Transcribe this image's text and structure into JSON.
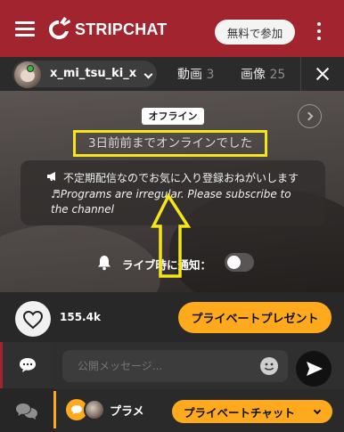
{
  "header": {
    "brand": "STRIPCHAT",
    "join_label": "無料で参加",
    "colors": {
      "brand_red": "#a2242f",
      "accent_orange": "#ffaa1c"
    }
  },
  "model_bar": {
    "model_name": "x_mi_tsu_ki_x",
    "tabs": [
      {
        "label": "動画",
        "count": "3"
      },
      {
        "label": "画像",
        "count": "25"
      }
    ]
  },
  "video": {
    "status_badge": "オフライン",
    "last_online": "3日前前までオンラインでした",
    "notice_ja": "不定期配信なのでお気に入り登録おねがいします",
    "notice_en": "♬Programs are irregular. Please subscribe to the channel",
    "notify_label": "ライブ時に通知："
  },
  "actions": {
    "like_count": "155.4k",
    "private_present_label": "プライベートプレゼント"
  },
  "chat": {
    "input_placeholder": "公開メッセージ...",
    "pm_user": "プラメ",
    "private_chat_label": "プライベートチャット"
  }
}
